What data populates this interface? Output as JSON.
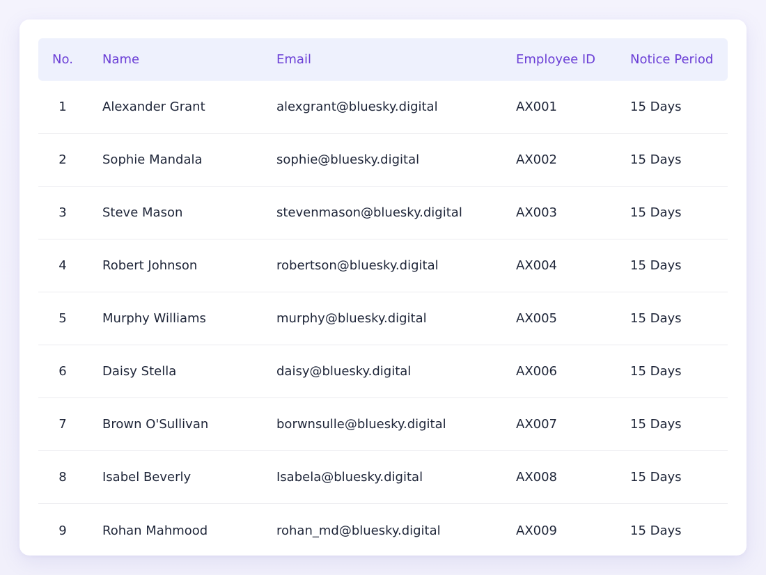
{
  "table": {
    "columns": {
      "no": "No.",
      "name": "Name",
      "email": "Email",
      "employee_id": "Employee ID",
      "notice_period": "Notice Period"
    },
    "rows": [
      {
        "no": "1",
        "name": "Alexander Grant",
        "email": "alexgrant@bluesky.digital",
        "employee_id": "AX001",
        "notice_period": "15 Days"
      },
      {
        "no": "2",
        "name": "Sophie Mandala",
        "email": "sophie@bluesky.digital",
        "employee_id": "AX002",
        "notice_period": "15 Days"
      },
      {
        "no": "3",
        "name": "Steve Mason",
        "email": "stevenmason@bluesky.digital",
        "employee_id": "AX003",
        "notice_period": "15 Days"
      },
      {
        "no": "4",
        "name": "Robert Johnson",
        "email": "robertson@bluesky.digital",
        "employee_id": "AX004",
        "notice_period": "15 Days"
      },
      {
        "no": "5",
        "name": "Murphy Williams",
        "email": "murphy@bluesky.digital",
        "employee_id": "AX005",
        "notice_period": "15 Days"
      },
      {
        "no": "6",
        "name": "Daisy Stella",
        "email": "daisy@bluesky.digital",
        "employee_id": "AX006",
        "notice_period": "15 Days"
      },
      {
        "no": "7",
        "name": "Brown O'Sullivan",
        "email": "borwnsulle@bluesky.digital",
        "employee_id": "AX007",
        "notice_period": "15 Days"
      },
      {
        "no": "8",
        "name": "Isabel Beverly",
        "email": "Isabela@bluesky.digital",
        "employee_id": "AX008",
        "notice_period": "15 Days"
      },
      {
        "no": "9",
        "name": "Rohan Mahmood",
        "email": "rohan_md@bluesky.digital",
        "employee_id": "AX009",
        "notice_period": "15 Days"
      }
    ]
  },
  "colors": {
    "header_text": "#6b3fd6",
    "header_background": "#eef1fd",
    "body_text": "#1e2538",
    "row_divider": "#ebebef",
    "page_background": "#f3f2fc",
    "card_background": "#ffffff"
  }
}
